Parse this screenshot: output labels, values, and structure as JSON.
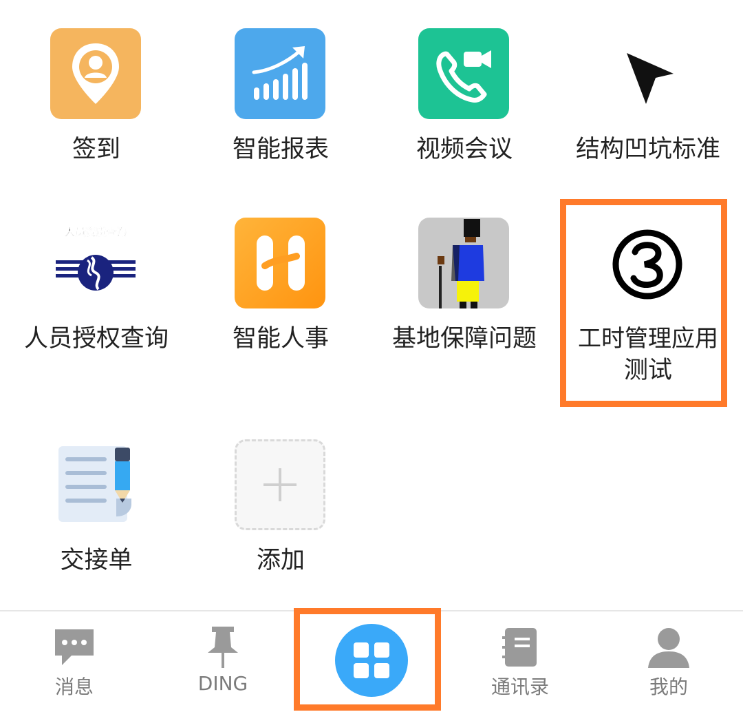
{
  "apps": [
    {
      "label": "签到",
      "icon": "location-person-icon",
      "color": "#F5B55E"
    },
    {
      "label": "智能报表",
      "icon": "bar-chart-trend-icon",
      "color": "#4DA8EC"
    },
    {
      "label": "视频会议",
      "icon": "video-call-icon",
      "color": "#1DC394"
    },
    {
      "label": "结构凹坑标准",
      "icon": "cursor-arrow-icon"
    },
    {
      "label": "人员授权查询",
      "icon": "personnel-logo-icon",
      "logo_text": "人员资质查询"
    },
    {
      "label": "智能人事",
      "icon": "h-logo-icon",
      "color": "#FFA21E"
    },
    {
      "label": "基地保障问题",
      "icon": "guard-figure-icon",
      "color": "#C8C8C8"
    },
    {
      "label_line1": "工时管理应用",
      "label_line2": "测试",
      "icon": "circled-3-icon"
    },
    {
      "label": "交接单",
      "icon": "document-pencil-icon"
    },
    {
      "label": "添加",
      "icon": "add-icon"
    }
  ],
  "tabs": [
    {
      "label": "消息",
      "icon": "chat-bubble-icon"
    },
    {
      "label": "DING",
      "icon": "pin-icon"
    },
    {
      "label": "",
      "icon": "apps-grid-icon",
      "color": "#3AA9F9"
    },
    {
      "label": "通讯录",
      "icon": "contacts-book-icon"
    },
    {
      "label": "我的",
      "icon": "person-icon"
    }
  ],
  "highlight_color": "#FF7A2A",
  "inactive_tab_color": "#9A9A9A"
}
